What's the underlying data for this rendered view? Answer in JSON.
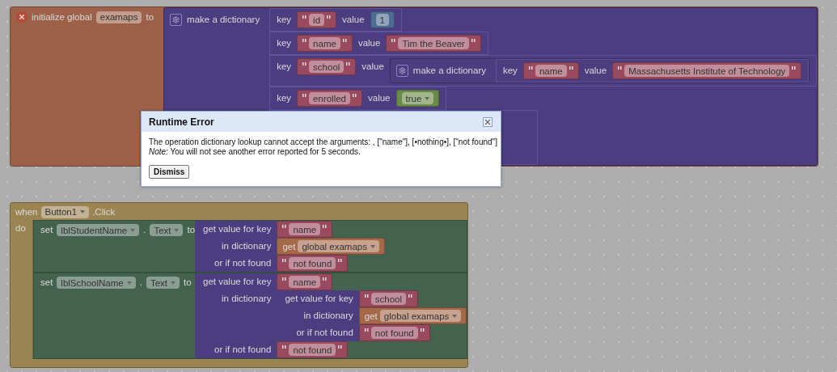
{
  "init_block": {
    "error": true,
    "label": "initialize global",
    "name": "examaps",
    "to": "to",
    "value": {
      "kind": "dictionary",
      "label": "make a dictionary",
      "pairs": [
        {
          "key_label": "key",
          "key": "id",
          "value_label": "value",
          "value": {
            "kind": "number",
            "text": "1"
          }
        },
        {
          "key_label": "key",
          "key": "name",
          "value_label": "value",
          "value": {
            "kind": "text",
            "text": "Tim the Beaver"
          }
        },
        {
          "key_label": "key",
          "key": "school",
          "value_label": "value",
          "value": {
            "kind": "dictionary",
            "label": "make a dictionary",
            "pairs": [
              {
                "key_label": "key",
                "key": "name",
                "value_label": "value",
                "value": {
                  "kind": "text",
                  "text": "Massachusetts Institute of Technology"
                }
              }
            ]
          }
        },
        {
          "key_label": "key",
          "key": "enrolled",
          "value_label": "value",
          "value": {
            "kind": "boolean",
            "text": "true"
          }
        }
      ]
    }
  },
  "event_block": {
    "when": "when",
    "component": "Button1",
    "event": ".Click",
    "do": "do",
    "statements": [
      {
        "set": "set",
        "component": "lblStudentName",
        "dot": ".",
        "property": "Text",
        "to": "to",
        "value": {
          "kind": "lookup",
          "rows": [
            {
              "label": "get value for key",
              "input": {
                "kind": "text",
                "text": "name"
              }
            },
            {
              "label": "in dictionary",
              "input": {
                "kind": "get",
                "label": "get",
                "variable": "global examaps"
              }
            },
            {
              "label": "or if not found",
              "input": {
                "kind": "text",
                "text": "not found"
              }
            }
          ]
        }
      },
      {
        "set": "set",
        "component": "lblSchoolName",
        "dot": ".",
        "property": "Text",
        "to": "to",
        "value": {
          "kind": "lookup",
          "rows": [
            {
              "label": "get value for key",
              "input": {
                "kind": "text",
                "text": "name"
              }
            },
            {
              "label": "in dictionary",
              "input": {
                "kind": "lookup",
                "rows": [
                  {
                    "label": "get value for key",
                    "input": {
                      "kind": "text",
                      "text": "school"
                    }
                  },
                  {
                    "label": "in dictionary",
                    "input": {
                      "kind": "get",
                      "label": "get",
                      "variable": "global examaps"
                    }
                  },
                  {
                    "label": "or if not found",
                    "input": {
                      "kind": "text",
                      "text": "not found"
                    }
                  }
                ]
              }
            },
            {
              "label": "or if not found",
              "input": {
                "kind": "text",
                "text": "not found"
              }
            }
          ]
        }
      }
    ]
  },
  "dialog": {
    "title": "Runtime Error",
    "message": "The operation dictionary lookup cannot accept the arguments: , [\"name\"], [•nothing•], [\"not found\"]",
    "note": "*Note:* You will not see another error reported for 5 seconds.",
    "button": "Dismiss"
  }
}
